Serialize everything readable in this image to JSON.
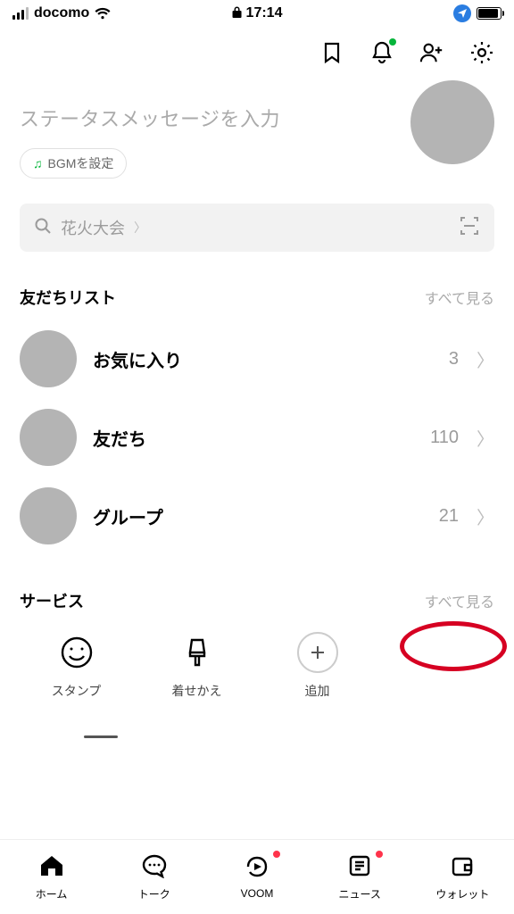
{
  "status_bar": {
    "carrier": "docomo",
    "time": "17:14"
  },
  "profile": {
    "status_placeholder": "ステータスメッセージを入力",
    "bgm_label": "BGMを設定"
  },
  "search": {
    "placeholder": "花火大会"
  },
  "friends": {
    "section_title": "友だちリスト",
    "see_all": "すべて見る",
    "items": [
      {
        "label": "お気に入り",
        "count": "3"
      },
      {
        "label": "友だち",
        "count": "110"
      },
      {
        "label": "グループ",
        "count": "21"
      }
    ]
  },
  "services": {
    "section_title": "サービス",
    "see_all": "すべて見る",
    "items": [
      {
        "label": "スタンプ"
      },
      {
        "label": "着せかえ"
      },
      {
        "label": "追加"
      }
    ]
  },
  "tabs": [
    {
      "label": "ホーム"
    },
    {
      "label": "トーク"
    },
    {
      "label": "VOOM"
    },
    {
      "label": "ニュース"
    },
    {
      "label": "ウォレット"
    }
  ]
}
